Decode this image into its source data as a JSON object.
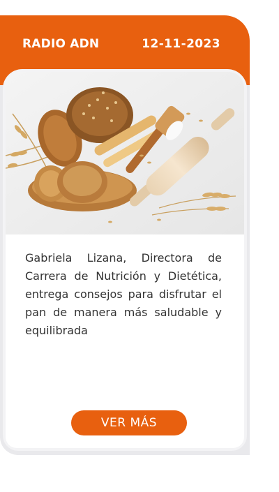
{
  "card": {
    "source": "RADIO ADN",
    "date": "12-11-2023",
    "image_alt": "Pan en canasta con trigo y rodillo",
    "description": "Gabriela Lizana, Directora de Carrera de Nutrición y Dietética, entrega consejos para disfrutar el pan de manera más saludable y equilibrada",
    "button_label": "VER MÁS"
  },
  "colors": {
    "accent": "#e8600f",
    "card_bg": "#e9e9ec"
  }
}
